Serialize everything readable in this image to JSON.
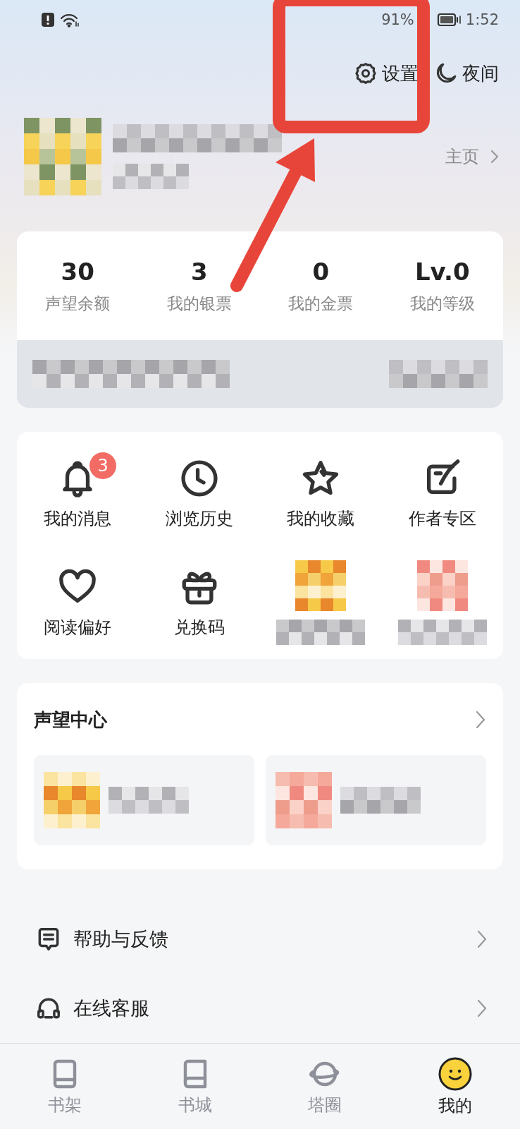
{
  "status_bar": {
    "battery": "91%",
    "time": "1:52"
  },
  "top_actions": [
    {
      "kind": "settings",
      "label": "设置"
    },
    {
      "kind": "night",
      "label": "夜间"
    }
  ],
  "profile": {
    "homepage_link": "主页"
  },
  "stats": [
    {
      "value": "30",
      "label": "声望余额"
    },
    {
      "value": "3",
      "label": "我的银票"
    },
    {
      "value": "0",
      "label": "我的金票"
    },
    {
      "value": "Lv.0",
      "label": "我的等级"
    }
  ],
  "shortcuts": [
    {
      "kind": "bell",
      "label": "我的消息",
      "badge": "3"
    },
    {
      "kind": "clock",
      "label": "浏览历史"
    },
    {
      "kind": "star",
      "label": "我的收藏"
    },
    {
      "kind": "note",
      "label": "作者专区"
    },
    {
      "kind": "heart",
      "label": "阅读偏好"
    },
    {
      "kind": "gift",
      "label": "兑换码"
    },
    {
      "kind": "blurred"
    },
    {
      "kind": "blurred"
    }
  ],
  "reputation_center": {
    "title": "声望中心"
  },
  "menu": [
    {
      "kind": "help",
      "label": "帮助与反馈"
    },
    {
      "kind": "headset",
      "label": "在线客服"
    }
  ],
  "nav": [
    {
      "kind": "shelf",
      "label": "书架",
      "selected": false
    },
    {
      "kind": "book",
      "label": "书城",
      "selected": false
    },
    {
      "kind": "planet",
      "label": "塔圈",
      "selected": false
    },
    {
      "kind": "face",
      "label": "我的",
      "selected": true
    }
  ]
}
